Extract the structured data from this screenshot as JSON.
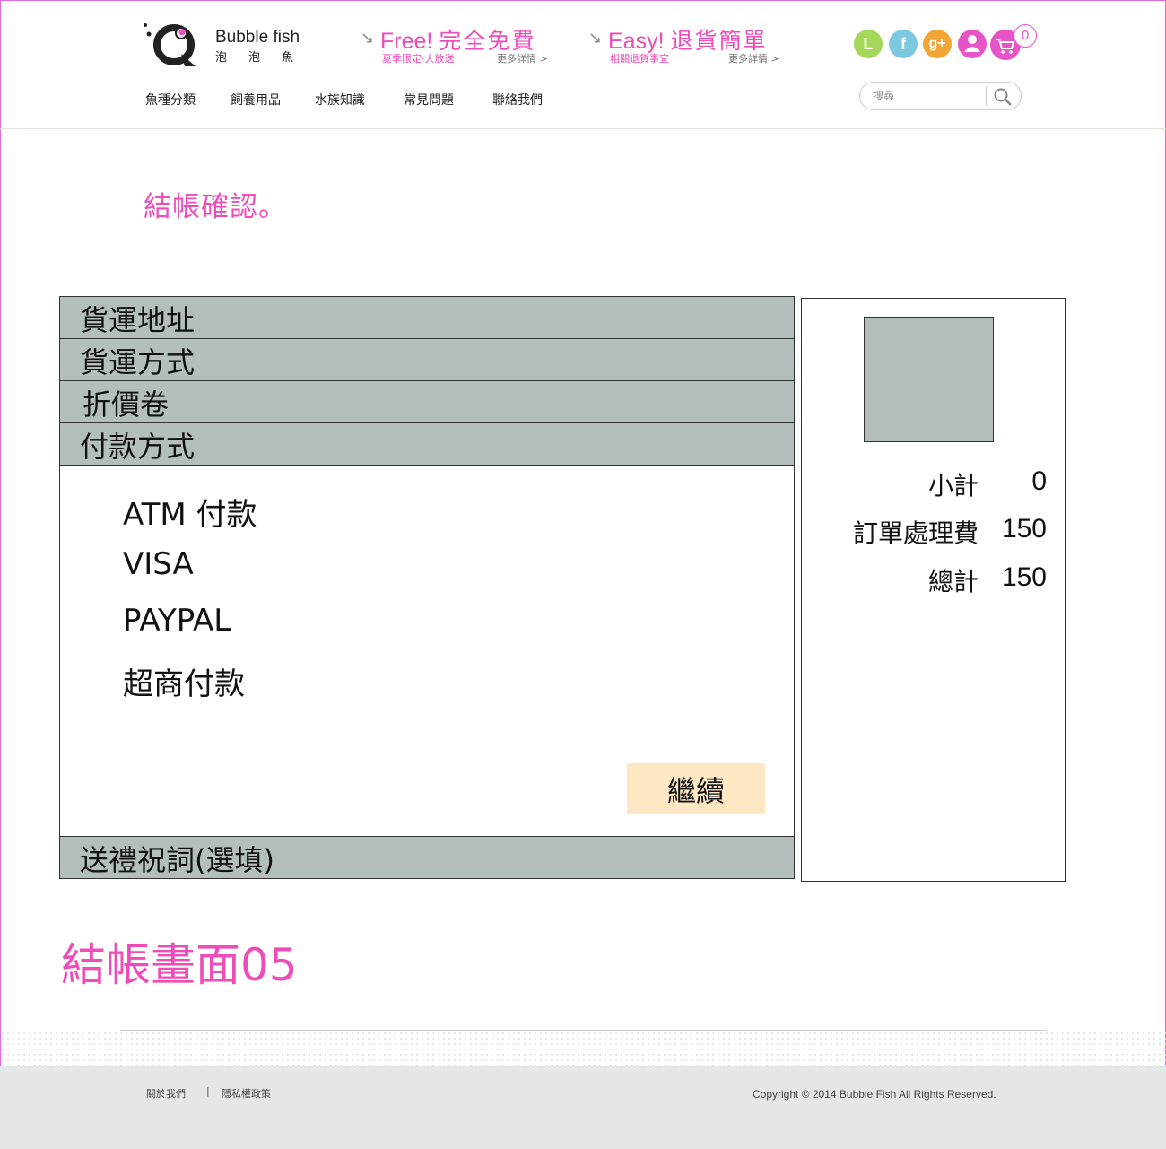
{
  "brand": {
    "name_en": "Bubble fish",
    "name_zh": "泡泡魚"
  },
  "promos": [
    {
      "headline_en": "Free!",
      "headline_zh": "完全免費",
      "sub": "夏季限定‧大放送",
      "more": "更多詳情 >"
    },
    {
      "headline_en": "Easy!",
      "headline_zh": "退貨簡單",
      "sub": "相關退貨事宜",
      "more": "更多詳情 >"
    }
  ],
  "social": {
    "line": "L",
    "facebook": "f",
    "google_plus": "g+"
  },
  "cart": {
    "count": "0"
  },
  "nav": [
    "魚種分類",
    "飼養用品",
    "水族知識",
    "常見問題",
    "聯絡我們"
  ],
  "search": {
    "placeholder": "搜尋"
  },
  "page_heading": "結帳確認。",
  "sections": {
    "shipping_address": "貨運地址",
    "shipping_method": "貨運方式",
    "coupon": "折價卷",
    "payment_method": "付款方式",
    "gift_message": "送禮祝詞(選填)"
  },
  "payment_options": [
    "ATM 付款",
    "VISA",
    "PAYPAL",
    "超商付款"
  ],
  "continue_label": "繼續",
  "summary": {
    "subtotal_label": "小計",
    "subtotal_value": "0",
    "fee_label": "訂單處理費",
    "fee_value": "150",
    "total_label": "總計",
    "total_value": "150"
  },
  "screen_label": "結帳畫面05",
  "footer": {
    "about": "關於我們",
    "separator": "|",
    "privacy": "隱私權政策",
    "copyright": "Copyright © 2014 Bubble Fish All Rights Reserved."
  },
  "colors": {
    "accent": "#ee4db9",
    "section_bar": "#b4bfbd",
    "button": "#fde8c3",
    "footer_bg": "#e3e7e7"
  }
}
